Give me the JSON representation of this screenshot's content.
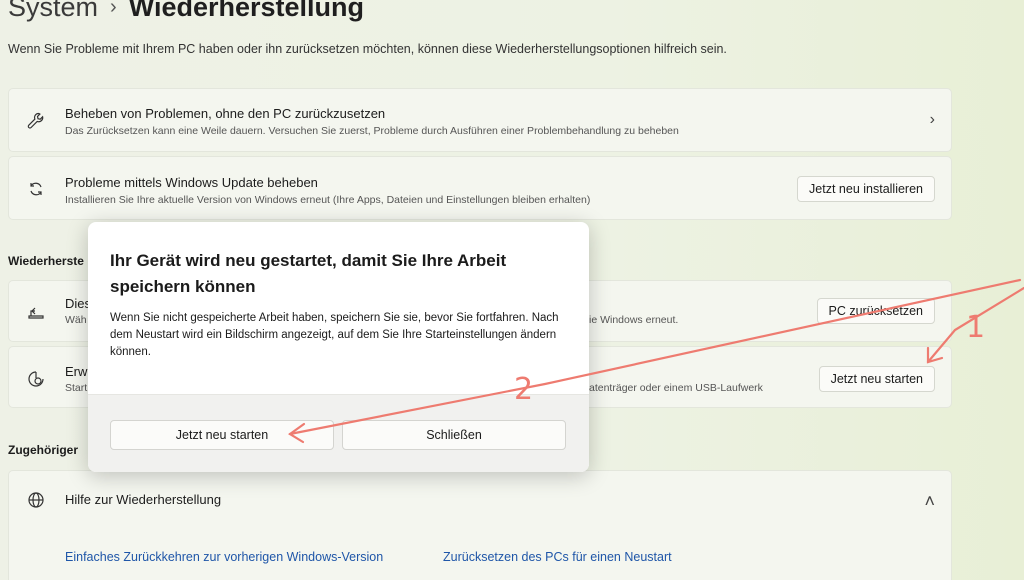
{
  "header": {
    "crumb": "System",
    "separator": "›",
    "title": "Wiederherstellung",
    "subtitle": "Wenn Sie Probleme mit Ihrem PC haben oder ihn zurücksetzen möchten, können diese Wiederherstellungsoptionen hilfreich sein."
  },
  "cards": {
    "troubleshoot": {
      "icon": "wrench-icon",
      "title": "Beheben von Problemen, ohne den PC zurückzusetzen",
      "desc": "Das Zurücksetzen kann eine Weile dauern. Versuchen Sie zuerst, Probleme durch Ausführen einer Problembehandlung zu beheben",
      "chevron": "›"
    },
    "windows_update": {
      "icon": "refresh-icon",
      "title": "Probleme mittels Windows Update beheben",
      "desc": "Installieren Sie Ihre aktuelle Version von Windows erneut (Ihre Apps, Dateien und Einstellungen bleiben erhalten)",
      "button": "Jetzt neu installieren"
    },
    "reset_pc": {
      "icon": "reset-pc-icon",
      "title_partial": "Dies",
      "desc_partial_left": "Wäh",
      "desc_partial_right": "ie Windows erneut.",
      "button": "PC zurücksetzen"
    },
    "advanced_start": {
      "icon": "advanced-startup-icon",
      "title_partial": "Erw",
      "desc_partial_left": "Start",
      "desc_partial_right": "atenträger oder einem USB-Laufwerk",
      "button": "Jetzt neu starten"
    },
    "help": {
      "icon": "globe-icon",
      "title": "Hilfe zur Wiederherstellung",
      "chevron": "˄"
    }
  },
  "sections": {
    "recovery_partial": "Wiederherste",
    "related_partial": "Zugehöriger"
  },
  "links": {
    "rollback": "Einfaches Zurückkehren zur vorherigen Windows-Version",
    "reset_restart": "Zurücksetzen des PCs für einen Neustart"
  },
  "dialog": {
    "title": "Ihr Gerät wird neu gestartet, damit Sie Ihre Arbeit speichern können",
    "body": "Wenn Sie nicht gespeicherte Arbeit haben, speichern Sie sie, bevor Sie fortfahren. Nach dem Neustart wird ein Bildschirm angezeigt, auf dem Sie Ihre Starteinstellungen ändern können.",
    "primary_button": "Jetzt neu starten",
    "close_button": "Schließen"
  },
  "annotations": {
    "step1": "1",
    "step2": "2",
    "color": "#ee7b70"
  }
}
